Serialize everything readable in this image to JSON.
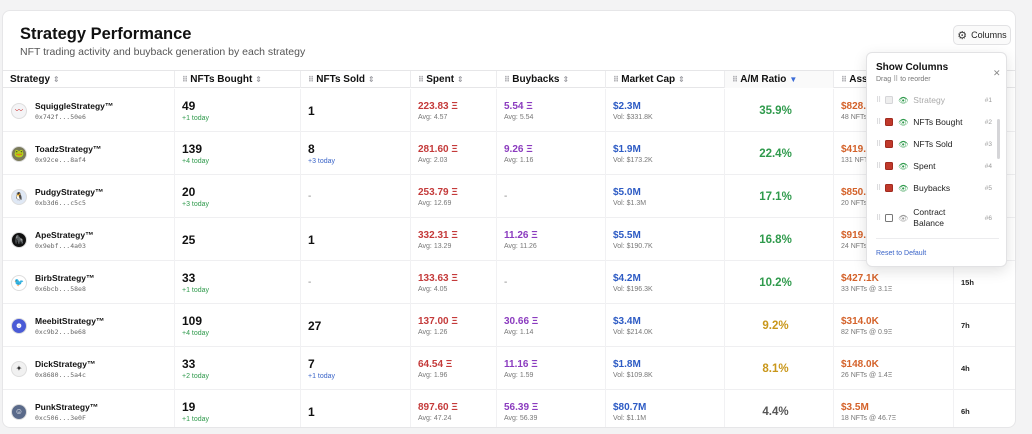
{
  "header": {
    "title": "Strategy Performance",
    "subtitle": "NFT trading activity and buyback generation by each strategy",
    "columns_button": "Columns"
  },
  "columns": {
    "strategy": "Strategy",
    "nfts_bought": "NFTs Bought",
    "nfts_sold": "NFTs Sold",
    "spent": "Spent",
    "buybacks": "Buybacks",
    "market_cap": "Market Cap",
    "am_ratio": "A/M Ratio",
    "assets": "Asse"
  },
  "rows": [
    {
      "name": "SquiggleStrategy™",
      "addr": "0x742f...50e6",
      "bought": "49",
      "bought_today": "+1 today",
      "sold": "1",
      "sold_today": "",
      "spent": "223.83 Ξ",
      "spent_avg": "Avg: 4.57",
      "buyback": "5.54 Ξ",
      "buyback_avg": "Avg: 5.54",
      "mcap": "$2.3M",
      "mcap_vol": "Vol: $331.8K",
      "ratio": "35.9%",
      "asset": "$828.",
      "asset_sub": "48 NFTs",
      "time": ""
    },
    {
      "name": "ToadzStrategy™",
      "addr": "0x92ce...8af4",
      "bought": "139",
      "bought_today": "+4 today",
      "sold": "8",
      "sold_today": "+3 today",
      "spent": "281.60 Ξ",
      "spent_avg": "Avg: 2.03",
      "buyback": "9.26 Ξ",
      "buyback_avg": "Avg: 1.16",
      "mcap": "$1.9M",
      "mcap_vol": "Vol: $173.2K",
      "ratio": "22.4%",
      "asset": "$419.",
      "asset_sub": "131 NFT",
      "time": ""
    },
    {
      "name": "PudgyStrategy™",
      "addr": "0xb3d6...c5c5",
      "bought": "20",
      "bought_today": "+3 today",
      "sold": "-",
      "sold_today": "",
      "spent": "253.79 Ξ",
      "spent_avg": "Avg: 12.69",
      "buyback": "-",
      "buyback_avg": "",
      "mcap": "$5.0M",
      "mcap_vol": "Vol: $1.3M",
      "ratio": "17.1%",
      "asset": "$850.",
      "asset_sub": "20 NFTs",
      "time": ""
    },
    {
      "name": "ApeStrategy™",
      "addr": "0x9ebf...4a03",
      "bought": "25",
      "bought_today": "",
      "sold": "1",
      "sold_today": "",
      "spent": "332.31 Ξ",
      "spent_avg": "Avg: 13.29",
      "buyback": "11.26 Ξ",
      "buyback_avg": "Avg: 11.26",
      "mcap": "$5.5M",
      "mcap_vol": "Vol: $190.7K",
      "ratio": "16.8%",
      "asset": "$919.",
      "asset_sub": "24 NFTs",
      "time": ""
    },
    {
      "name": "BirbStrategy™",
      "addr": "0x6bcb...58e8",
      "bought": "33",
      "bought_today": "+1 today",
      "sold": "-",
      "sold_today": "",
      "spent": "133.63 Ξ",
      "spent_avg": "Avg: 4.05",
      "buyback": "-",
      "buyback_avg": "",
      "mcap": "$4.2M",
      "mcap_vol": "Vol: $196.3K",
      "ratio": "10.2%",
      "asset": "$427.1K",
      "asset_sub": "33 NFTs @ 3.1Ξ",
      "time": "15h"
    },
    {
      "name": "MeebitStrategy™",
      "addr": "0xc9b2...be68",
      "bought": "109",
      "bought_today": "+4 today",
      "sold": "27",
      "sold_today": "",
      "spent": "137.00 Ξ",
      "spent_avg": "Avg: 1.26",
      "buyback": "30.66 Ξ",
      "buyback_avg": "Avg: 1.14",
      "mcap": "$3.4M",
      "mcap_vol": "Vol: $214.0K",
      "ratio": "9.2%",
      "asset": "$314.0K",
      "asset_sub": "82 NFTs @ 0.9Ξ",
      "time": "7h"
    },
    {
      "name": "DickStrategy™",
      "addr": "0x8680...5a4c",
      "bought": "33",
      "bought_today": "+2 today",
      "sold": "7",
      "sold_today": "+1 today",
      "spent": "64.54 Ξ",
      "spent_avg": "Avg: 1.96",
      "buyback": "11.16 Ξ",
      "buyback_avg": "Avg: 1.59",
      "mcap": "$1.8M",
      "mcap_vol": "Vol: $109.8K",
      "ratio": "8.1%",
      "asset": "$148.0K",
      "asset_sub": "26 NFTs @ 1.4Ξ",
      "time": "4h"
    },
    {
      "name": "PunkStrategy™",
      "addr": "0xc506...3e0F",
      "bought": "19",
      "bought_today": "+1 today",
      "sold": "1",
      "sold_today": "",
      "spent": "897.60 Ξ",
      "spent_avg": "Avg: 47.24",
      "buyback": "56.39 Ξ",
      "buyback_avg": "Avg: 56.39",
      "mcap": "$80.7M",
      "mcap_vol": "Vol: $1.1M",
      "ratio": "4.4%",
      "asset": "$3.5M",
      "asset_sub": "18 NFTs @ 46.7Ξ",
      "time": "6h"
    }
  ],
  "panel": {
    "title": "Show Columns",
    "subtitle": "Drag ⠿ to reorder",
    "items": [
      {
        "label": "Strategy",
        "num": "#1"
      },
      {
        "label": "NFTs Bought",
        "num": "#2"
      },
      {
        "label": "NFTs Sold",
        "num": "#3"
      },
      {
        "label": "Spent",
        "num": "#4"
      },
      {
        "label": "Buybacks",
        "num": "#5"
      },
      {
        "label": "Contract",
        "label2": "Balance",
        "num": "#6"
      }
    ],
    "reset": "Reset to Default"
  },
  "colors": {
    "spent": "#c43a3a",
    "buyback": "#8b3bbf",
    "market_cap": "#2d5bc4",
    "assets": "#d4622a",
    "ratio_green": "#2f9a4c",
    "ratio_yellow": "#c9971a"
  }
}
